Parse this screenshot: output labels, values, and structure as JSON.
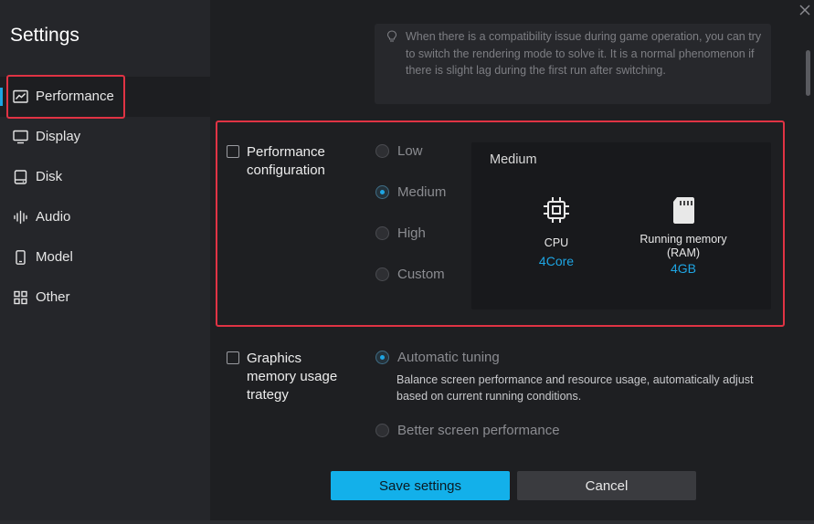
{
  "window": {
    "title": "Settings"
  },
  "sidebar": {
    "items": [
      {
        "label": "Performance",
        "icon": "chart-icon",
        "active": true
      },
      {
        "label": "Display",
        "icon": "monitor-icon"
      },
      {
        "label": "Disk",
        "icon": "disk-icon"
      },
      {
        "label": "Audio",
        "icon": "audio-wave-icon"
      },
      {
        "label": "Model",
        "icon": "phone-icon"
      },
      {
        "label": "Other",
        "icon": "grid-icon"
      }
    ]
  },
  "tip": {
    "icon": "lightbulb-icon",
    "text": "When there is a compatibility issue during game operation, you can try to switch the rendering mode to solve it. It is a normal phenomenon if there is slight lag during the first run after switching."
  },
  "performance": {
    "label": "Performance configuration",
    "checked": false,
    "options": [
      {
        "label": "Low",
        "selected": false
      },
      {
        "label": "Medium",
        "selected": true
      },
      {
        "label": "High",
        "selected": false
      },
      {
        "label": "Custom",
        "selected": false
      }
    ],
    "panel": {
      "title": "Medium",
      "cpu": {
        "name": "CPU",
        "value": "4Core",
        "icon": "cpu-chip-icon"
      },
      "ram": {
        "name": "Running memory (RAM)",
        "value": "4GB",
        "icon": "sd-card-icon"
      }
    }
  },
  "graphics": {
    "label": "Graphics memory usage trategy",
    "checked": false,
    "options": [
      {
        "label": "Automatic tuning",
        "selected": true,
        "description": "Balance screen performance and resource usage, automatically adjust based on current running conditions."
      },
      {
        "label": "Better screen performance",
        "selected": false
      }
    ]
  },
  "footer": {
    "save_label": "Save settings",
    "cancel_label": "Cancel"
  },
  "colors": {
    "accent": "#1ea5e3",
    "highlight": "#e03344",
    "background": "#1e1f22",
    "sidebar": "#25262a"
  }
}
